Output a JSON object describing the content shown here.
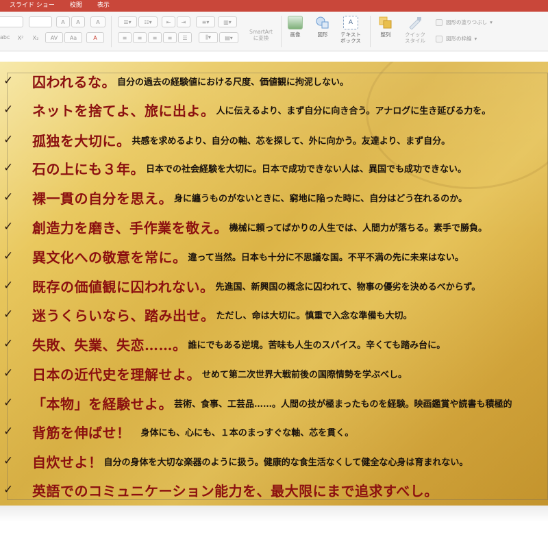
{
  "menu": {
    "items": [
      "スライド ショー",
      "校閲",
      "表示"
    ]
  },
  "ribbon": {
    "font": {
      "grow_label": "A",
      "shrink_label": "A",
      "clear_label": "A",
      "superscript_label": "X²",
      "subscript_label": "X₂",
      "spacing_label": "AV",
      "case_label": "Aa",
      "abc_label": "abc"
    },
    "smartart": {
      "label": "SmartArt\nに変換"
    },
    "picture": {
      "label": "画像"
    },
    "shape": {
      "label": "図形"
    },
    "textbox": {
      "label": "テキスト\nボックス"
    },
    "arrange": {
      "label": "整列"
    },
    "quick_style": {
      "label": "クイック\nスタイル"
    },
    "shape_fill": {
      "label": "図形の塗りつぶし"
    },
    "shape_outline": {
      "label": "図形の枠線"
    },
    "colors": {
      "accent": "#c9473a",
      "picture_icon": "#7fb07a",
      "shape_icon": "#6a9bd2",
      "arrange_icon": "#e3b23c",
      "quick_style_icon": "#b9c6d6"
    }
  },
  "slide": {
    "items": [
      {
        "heading": "囚われるな。",
        "body": "自分の過去の経験値における尺度、価値観に拘泥しない。"
      },
      {
        "heading": "ネットを捨てよ、旅に出よ。",
        "body": "人に伝えるより、まず自分に向き合う。アナログに生き延びる力を。"
      },
      {
        "heading": "孤独を大切に。",
        "body": "共感を求めるより、自分の軸、芯を探して、外に向かう。友達より、まず自分。"
      },
      {
        "heading": "石の上にも３年。",
        "body": "日本での社会経験を大切に。日本で成功できない人は、異国でも成功できない。"
      },
      {
        "heading": "裸一貫の自分を思え。",
        "body": "身に纏うものがないときに、窮地に陥った時に、自分はどう在れるのか。"
      },
      {
        "heading": "創造力を磨き、手作業を敬え。",
        "body": "機械に頼ってばかりの人生では、人間力が落ちる。素手で勝負。"
      },
      {
        "heading": "異文化への敬意を常に。",
        "body": "違って当然。日本も十分に不思議な国。不平不満の先に未来はない。"
      },
      {
        "heading": "既存の価値観に囚われない。",
        "body": "先進国、新興国の概念に囚われて、物事の優劣を決めるべからず。"
      },
      {
        "heading": "迷うくらいなら、踏み出せ。",
        "body": "ただし、命は大切に。慎重で入念な準備も大切。"
      },
      {
        "heading": "失敗、失業、失恋……。",
        "body": "誰にでもある逆境。苦味も人生のスパイス。辛くても踏み台に。"
      },
      {
        "heading": "日本の近代史を理解せよ。",
        "body": "せめて第二次世界大戦前後の国際情勢を学ぶべし。"
      },
      {
        "heading": "「本物」を経験せよ。",
        "body": "芸術、食事、工芸品……。人間の技が極まったものを経験。映画鑑賞や読書も積極的"
      },
      {
        "heading": "背筋を伸ばせ！",
        "body": "　身体にも、心にも、１本のまっすぐな軸、芯を貫く。"
      },
      {
        "heading": "自炊せよ！",
        "body": "自分の身体を大切な楽器のように扱う。健康的な食生活なくして健全な心身は育まれない。"
      },
      {
        "heading": "英語でのコミュニケーション能力を、最大限にまで追求すべし。",
        "body": ""
      }
    ],
    "check_symbol": "✓",
    "colors": {
      "heading": "#8b1010",
      "body": "#1a120c",
      "background": "#dcb447"
    }
  }
}
